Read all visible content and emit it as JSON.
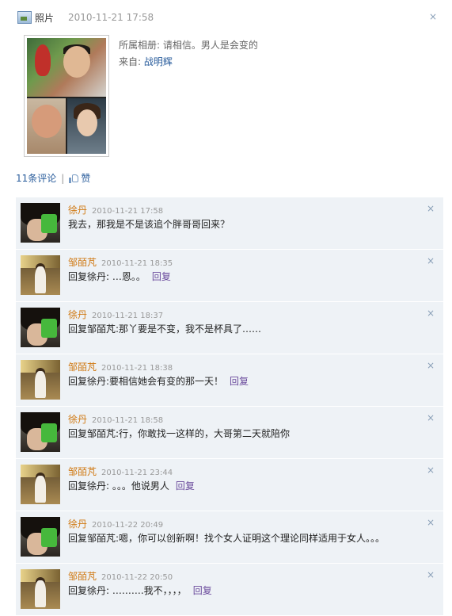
{
  "header": {
    "type_label": "照片",
    "timestamp": "2010-11-21 17:58",
    "close_glyph": "×",
    "photo_icon": "photo-icon"
  },
  "photo": {
    "album_label": "所属相册:",
    "album_name": "请相信。男人是会变的",
    "from_label": "来自:",
    "from_name": "战明辉"
  },
  "actions": {
    "comment_count": "11条评论",
    "separator": "|",
    "like_label": "赞",
    "like_icon": "thumbs-up-icon"
  },
  "colors": {
    "name": "#d07a15",
    "link": "#2a5d9c",
    "reply": "#6a4a9c",
    "comment_bg": "#eef2f6"
  },
  "comments": [
    {
      "name": "徐丹",
      "time": "2010-11-21 17:58",
      "text": "我去，那我是不是该追个胖哥哥回来？",
      "reply": "",
      "close": "×"
    },
    {
      "name": "邹皕芃",
      "time": "2010-11-21 18:35",
      "text": "回复徐丹: …恩。。",
      "reply": "回复",
      "close": "×"
    },
    {
      "name": "徐丹",
      "time": "2010-11-21 18:37",
      "text": "回复邹皕芃:那丫要是不变，我不是杯具了……",
      "reply": "",
      "close": "×"
    },
    {
      "name": "邹皕芃",
      "time": "2010-11-21 18:38",
      "text": "回复徐丹:要相信她会有变的那一天！",
      "reply": "回复",
      "close": "×"
    },
    {
      "name": "徐丹",
      "time": "2010-11-21 18:58",
      "text": "回复邹皕芃:行，你敢找一这样的，大哥第二天就陪你",
      "reply": "",
      "close": "×"
    },
    {
      "name": "邹皕芃",
      "time": "2010-11-21 23:44",
      "text": "回复徐丹: 。。。他说男人",
      "reply": "回复",
      "close": "×"
    },
    {
      "name": "徐丹",
      "time": "2010-11-22 20:49",
      "text": "回复邹皕芃:嗯，你可以创新啊！找个女人证明这个理论同样适用于女人。。。",
      "reply": "",
      "close": "×"
    },
    {
      "name": "邹皕芃",
      "time": "2010-11-22 20:50",
      "text": "回复徐丹: ……….我不，，，，",
      "reply": "回复",
      "close": "×"
    }
  ]
}
